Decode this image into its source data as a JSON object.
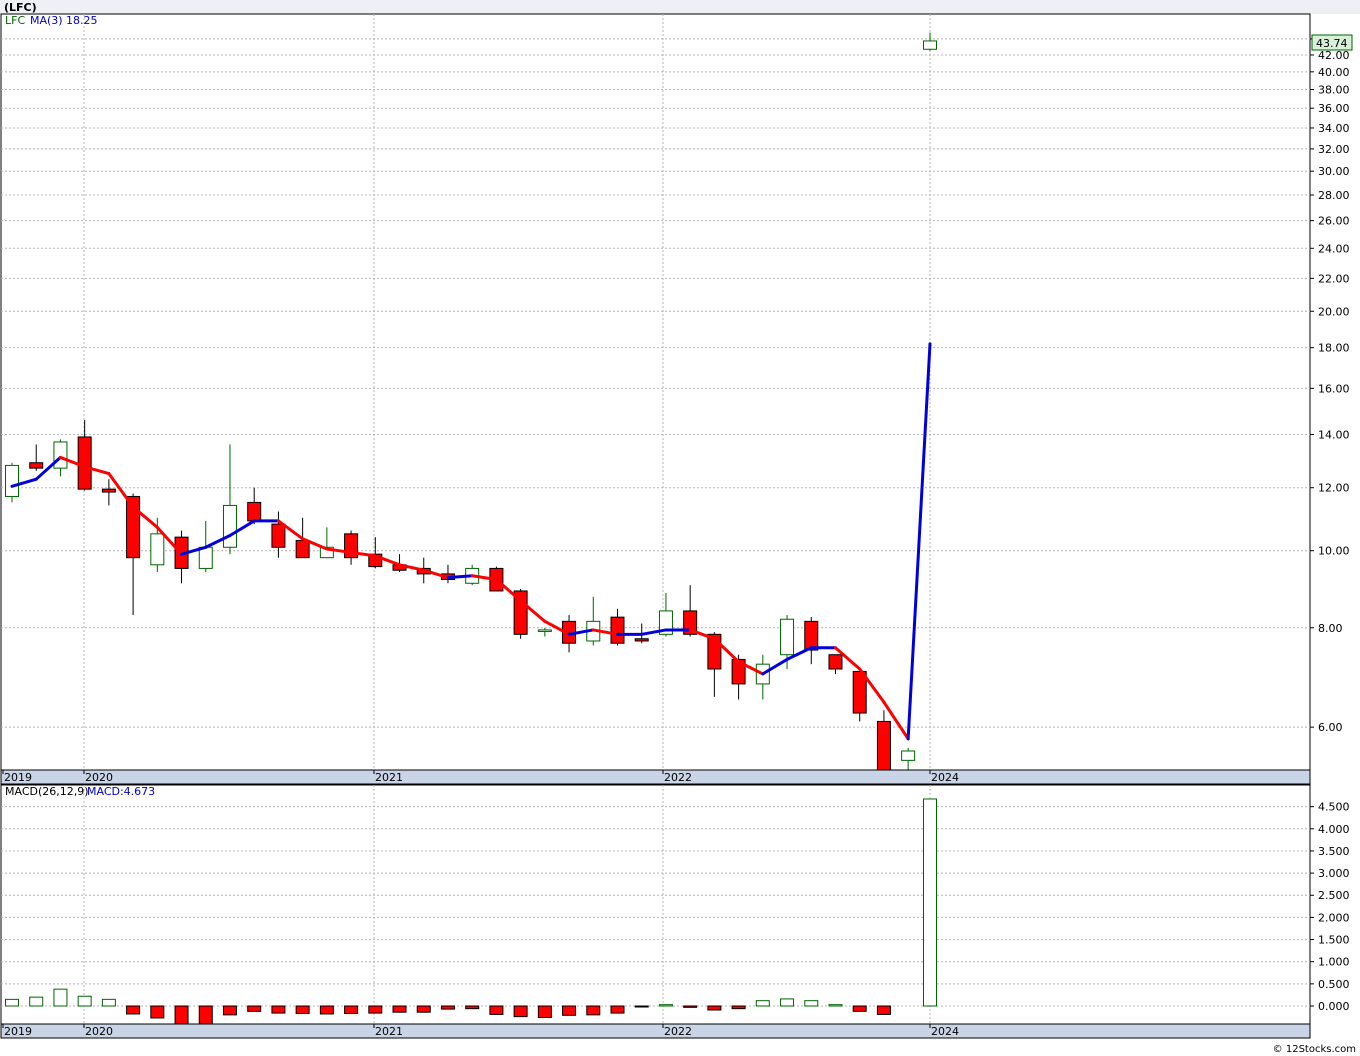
{
  "header": {
    "symbol_title": "(LFC)",
    "price_legend": "LFC",
    "ma_label": "MA(3)",
    "ma_value": "18.25",
    "macd_params": "MACD(26,12,9)",
    "macd_value_label": "MACD:4.673",
    "last_price": "43.74",
    "copyright": "© 12Stocks.com"
  },
  "colors": {
    "up_body": "#ffffff",
    "up_border": "#006400",
    "down_body": "#ff0000",
    "down_border": "#000000",
    "ma_up": "#0000dd",
    "ma_down": "#ff0000",
    "grid": "#b4b4b4",
    "axis_band": "#e8ecf4",
    "timeline": "#c9d4e6",
    "last_price_bg": "#d7f0d7"
  },
  "chart_data": [
    {
      "type": "candlestick",
      "title": "(LFC)",
      "scale": "log",
      "ylim": [
        5.3,
        44.5
      ],
      "y_ticks": [
        "6.00",
        "8.00",
        "10.00",
        "12.00",
        "14.00",
        "16.00",
        "18.00",
        "20.00",
        "22.00",
        "24.00",
        "26.00",
        "28.00",
        "30.00",
        "32.00",
        "34.00",
        "36.00",
        "38.00",
        "40.00",
        "42.00",
        "44.00"
      ],
      "x_ticks": [
        "2019",
        "2020",
        "2021",
        "2022",
        "2024"
      ],
      "candles": [
        {
          "o": 11.7,
          "h": 12.9,
          "l": 11.5,
          "c": 12.8
        },
        {
          "o": 12.9,
          "h": 13.6,
          "l": 12.6,
          "c": 12.7
        },
        {
          "o": 12.7,
          "h": 13.8,
          "l": 12.4,
          "c": 13.7
        },
        {
          "o": 13.9,
          "h": 14.6,
          "l": 11.9,
          "c": 11.95
        },
        {
          "o": 11.95,
          "h": 12.3,
          "l": 11.4,
          "c": 11.85
        },
        {
          "o": 11.7,
          "h": 11.8,
          "l": 8.3,
          "c": 9.8
        },
        {
          "o": 9.6,
          "h": 11.0,
          "l": 9.4,
          "c": 10.5
        },
        {
          "o": 10.4,
          "h": 10.6,
          "l": 9.1,
          "c": 9.5
        },
        {
          "o": 9.5,
          "h": 10.9,
          "l": 9.4,
          "c": 10.1
        },
        {
          "o": 10.1,
          "h": 13.6,
          "l": 9.9,
          "c": 11.4
        },
        {
          "o": 11.5,
          "h": 12.0,
          "l": 10.8,
          "c": 10.9
        },
        {
          "o": 10.8,
          "h": 11.2,
          "l": 9.8,
          "c": 10.1
        },
        {
          "o": 10.3,
          "h": 11.0,
          "l": 9.8,
          "c": 9.8
        },
        {
          "o": 9.8,
          "h": 10.7,
          "l": 9.8,
          "c": 10.1
        },
        {
          "o": 10.5,
          "h": 10.6,
          "l": 9.6,
          "c": 9.8
        },
        {
          "o": 9.9,
          "h": 10.4,
          "l": 9.5,
          "c": 9.55
        },
        {
          "o": 9.6,
          "h": 9.9,
          "l": 9.4,
          "c": 9.45
        },
        {
          "o": 9.5,
          "h": 9.8,
          "l": 9.1,
          "c": 9.35
        },
        {
          "o": 9.35,
          "h": 9.6,
          "l": 9.1,
          "c": 9.2
        },
        {
          "o": 9.1,
          "h": 9.6,
          "l": 9.05,
          "c": 9.5
        },
        {
          "o": 9.5,
          "h": 9.55,
          "l": 8.9,
          "c": 8.9
        },
        {
          "o": 8.9,
          "h": 8.95,
          "l": 7.75,
          "c": 7.85
        },
        {
          "o": 7.95,
          "h": 8.0,
          "l": 7.8,
          "c": 7.95
        },
        {
          "o": 8.15,
          "h": 8.3,
          "l": 7.45,
          "c": 7.65
        },
        {
          "o": 7.7,
          "h": 8.75,
          "l": 7.6,
          "c": 8.15
        },
        {
          "o": 8.25,
          "h": 8.45,
          "l": 7.6,
          "c": 7.65
        },
        {
          "o": 7.75,
          "h": 8.1,
          "l": 7.65,
          "c": 7.7
        },
        {
          "o": 7.85,
          "h": 8.85,
          "l": 7.8,
          "c": 8.4
        },
        {
          "o": 8.4,
          "h": 9.05,
          "l": 7.8,
          "c": 7.85
        },
        {
          "o": 7.85,
          "h": 7.9,
          "l": 6.55,
          "c": 7.1
        },
        {
          "o": 7.3,
          "h": 7.4,
          "l": 6.5,
          "c": 6.8
        },
        {
          "o": 6.8,
          "h": 7.4,
          "l": 6.5,
          "c": 7.2
        },
        {
          "o": 7.4,
          "h": 8.3,
          "l": 7.1,
          "c": 8.2
        },
        {
          "o": 8.15,
          "h": 8.25,
          "l": 7.2,
          "c": 7.5
        },
        {
          "o": 7.4,
          "h": 7.4,
          "l": 7.0,
          "c": 7.1
        },
        {
          "o": 7.05,
          "h": 7.05,
          "l": 6.1,
          "c": 6.25
        },
        {
          "o": 6.1,
          "h": 6.3,
          "l": 5.3,
          "c": 5.3
        },
        {
          "o": 5.45,
          "h": 5.65,
          "l": 5.3,
          "c": 5.6
        },
        {
          "o": 42.7,
          "h": 44.8,
          "l": 42.5,
          "c": 43.74
        }
      ],
      "ma3": [
        {
          "i": 0,
          "v": 12.05
        },
        {
          "i": 1,
          "v": 12.3
        },
        {
          "i": 2,
          "v": 13.1
        },
        {
          "i": 3,
          "v": 12.75
        },
        {
          "i": 4,
          "v": 12.5
        },
        {
          "i": 5,
          "v": 11.35
        },
        {
          "i": 6,
          "v": 10.7
        },
        {
          "i": 7,
          "v": 9.9
        },
        {
          "i": 8,
          "v": 10.1
        },
        {
          "i": 9,
          "v": 10.45
        },
        {
          "i": 10,
          "v": 10.9
        },
        {
          "i": 11,
          "v": 10.9
        },
        {
          "i": 12,
          "v": 10.35
        },
        {
          "i": 13,
          "v": 10.05
        },
        {
          "i": 14,
          "v": 9.95
        },
        {
          "i": 15,
          "v": 9.85
        },
        {
          "i": 16,
          "v": 9.6
        },
        {
          "i": 17,
          "v": 9.45
        },
        {
          "i": 18,
          "v": 9.25
        },
        {
          "i": 19,
          "v": 9.3
        },
        {
          "i": 20,
          "v": 9.2
        },
        {
          "i": 21,
          "v": 8.65
        },
        {
          "i": 22,
          "v": 8.15
        },
        {
          "i": 23,
          "v": 7.85
        },
        {
          "i": 24,
          "v": 7.95
        },
        {
          "i": 25,
          "v": 7.85
        },
        {
          "i": 26,
          "v": 7.85
        },
        {
          "i": 27,
          "v": 7.95
        },
        {
          "i": 28,
          "v": 7.95
        },
        {
          "i": 29,
          "v": 7.75
        },
        {
          "i": 30,
          "v": 7.25
        },
        {
          "i": 31,
          "v": 7.0
        },
        {
          "i": 32,
          "v": 7.3
        },
        {
          "i": 33,
          "v": 7.55
        },
        {
          "i": 34,
          "v": 7.55
        },
        {
          "i": 35,
          "v": 7.1
        },
        {
          "i": 36,
          "v": 6.45
        },
        {
          "i": 37,
          "v": 5.8
        },
        {
          "i": 38,
          "v": 18.2
        }
      ]
    },
    {
      "type": "bar",
      "title": "MACD(26,12,9)",
      "ylim": [
        -0.45,
        4.7
      ],
      "y_ticks": [
        "0.000",
        "0.500",
        "1.000",
        "1.500",
        "2.000",
        "2.500",
        "3.000",
        "3.500",
        "4.000",
        "4.500"
      ],
      "x_ticks": [
        "2019",
        "2020",
        "2021",
        "2022",
        "2024"
      ],
      "values": [
        0.15,
        0.2,
        0.38,
        0.22,
        0.15,
        -0.18,
        -0.27,
        -0.42,
        -0.45,
        -0.2,
        -0.12,
        -0.16,
        -0.17,
        -0.18,
        -0.17,
        -0.16,
        -0.14,
        -0.14,
        -0.07,
        -0.06,
        -0.19,
        -0.24,
        -0.26,
        -0.21,
        -0.2,
        -0.16,
        -0.01,
        0.03,
        -0.03,
        -0.09,
        -0.06,
        0.12,
        0.16,
        0.12,
        0.03,
        -0.12,
        -0.19,
        4.673
      ]
    }
  ]
}
